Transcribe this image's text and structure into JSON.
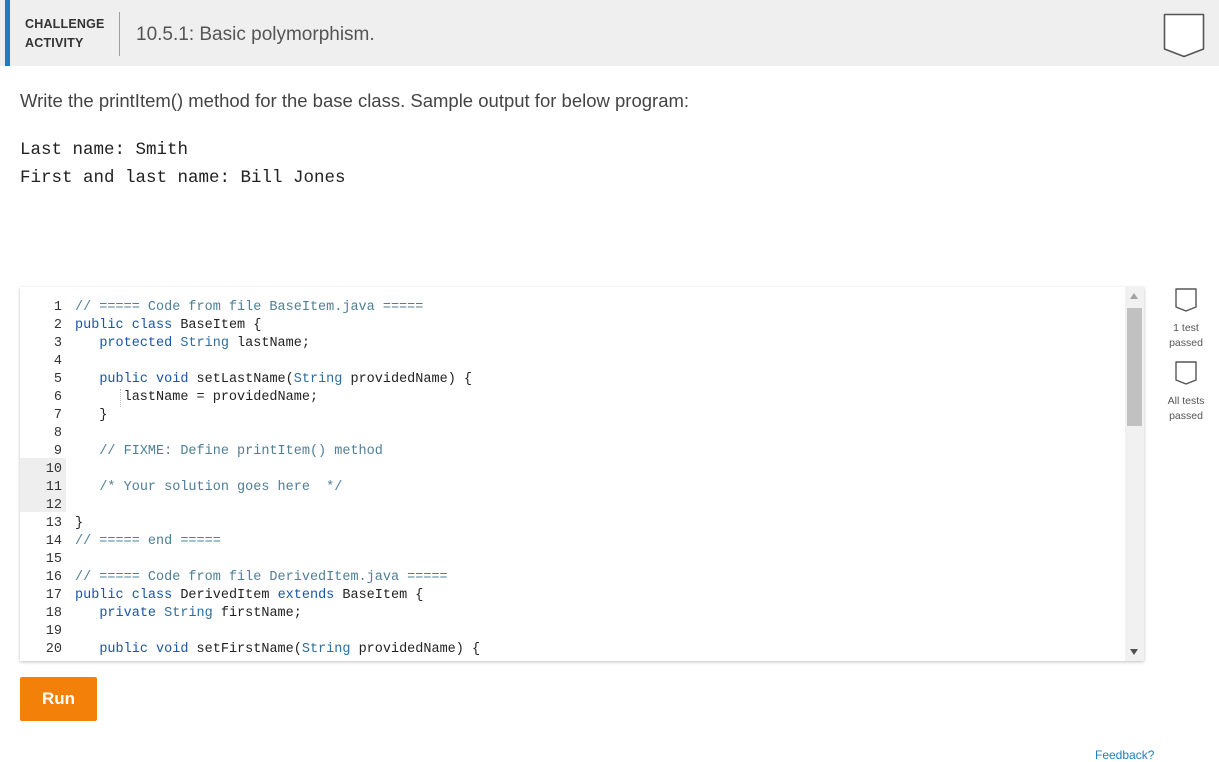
{
  "header": {
    "badge_line1": "CHALLENGE",
    "badge_line2": "ACTIVITY",
    "title": "10.5.1: Basic polymorphism.",
    "accent_color": "#1e7bc4"
  },
  "instructions": "Write the printItem() method for the base class. Sample output for below program:",
  "sample_output": [
    "Last name: Smith",
    "First and last name: Bill Jones"
  ],
  "editor": {
    "lines": [
      {
        "n": "1",
        "t": "// ===== Code from file BaseItem.java ====="
      },
      {
        "n": "2",
        "t": "public class BaseItem {"
      },
      {
        "n": "3",
        "t": "   protected String lastName;"
      },
      {
        "n": "4",
        "t": ""
      },
      {
        "n": "5",
        "t": "   public void setLastName(String providedName) {"
      },
      {
        "n": "6",
        "t": "      lastName = providedName;"
      },
      {
        "n": "7",
        "t": "   }"
      },
      {
        "n": "8",
        "t": ""
      },
      {
        "n": "9",
        "t": "   // FIXME: Define printItem() method"
      },
      {
        "n": "10",
        "t": ""
      },
      {
        "n": "11",
        "t": "   /* Your solution goes here  */"
      },
      {
        "n": "12",
        "t": ""
      },
      {
        "n": "13",
        "t": "}"
      },
      {
        "n": "14",
        "t": "// ===== end ====="
      },
      {
        "n": "15",
        "t": ""
      },
      {
        "n": "16",
        "t": "// ===== Code from file DerivedItem.java ====="
      },
      {
        "n": "17",
        "t": "public class DerivedItem extends BaseItem {"
      },
      {
        "n": "18",
        "t": "   private String firstName;"
      },
      {
        "n": "19",
        "t": ""
      },
      {
        "n": "20",
        "t": "   public void setFirstName(String providedName) {"
      }
    ]
  },
  "tests": [
    {
      "line1": "1 test",
      "line2": "passed"
    },
    {
      "line1": "All tests",
      "line2": "passed"
    }
  ],
  "run_label": "Run",
  "run_color": "#f38109",
  "bottom_peek": "Feedback?"
}
